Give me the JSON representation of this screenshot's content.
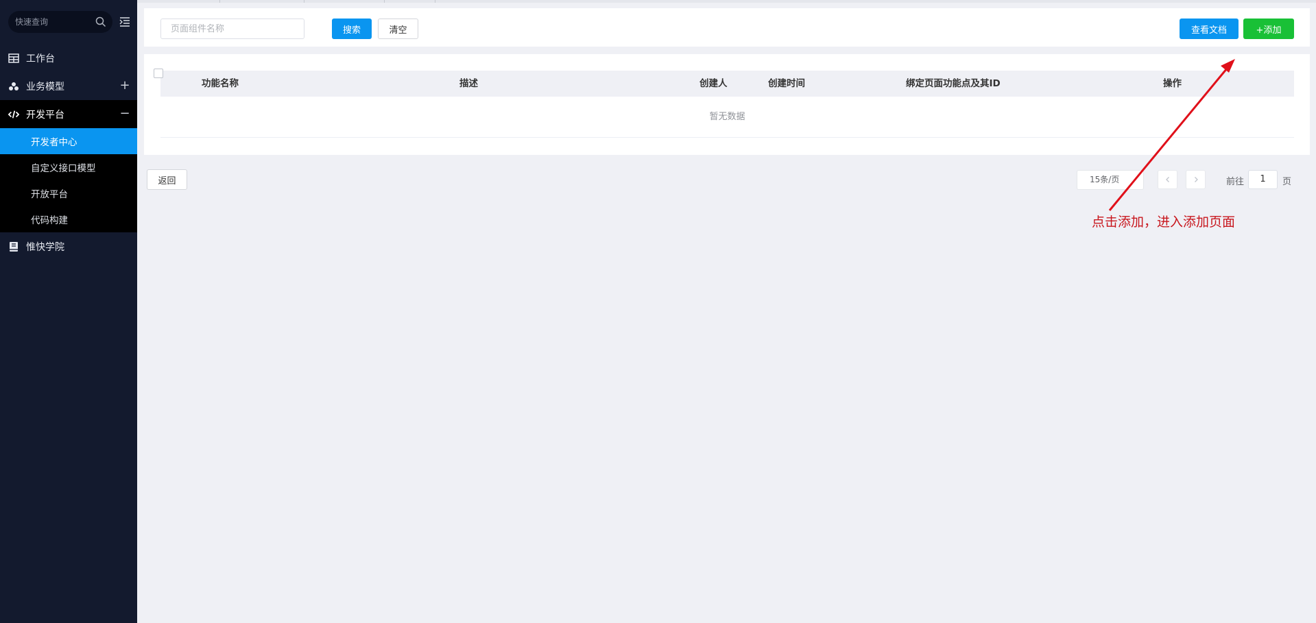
{
  "sidebar": {
    "search_placeholder": "快速查询",
    "items": [
      {
        "label": "工作台"
      },
      {
        "label": "业务模型",
        "toggle": "+"
      },
      {
        "label": "开发平台",
        "toggle": "−"
      },
      {
        "label": "惟快学院"
      }
    ],
    "subitems": [
      {
        "label": "开发者中心"
      },
      {
        "label": "自定义接口模型"
      },
      {
        "label": "开放平台"
      },
      {
        "label": "代码构建"
      }
    ]
  },
  "toolbar": {
    "search_placeholder": "页面组件名称",
    "search_label": "搜索",
    "clear_label": "清空",
    "docs_label": "查看文档",
    "add_label": "+添加"
  },
  "table": {
    "columns": [
      "功能名称",
      "描述",
      "创建人",
      "创建时间",
      "绑定页面功能点及其ID",
      "操作"
    ],
    "empty_text": "暂无数据"
  },
  "footer": {
    "back_label": "返回",
    "page_size": "15条/页",
    "goto_label": "前往",
    "page": "1",
    "page_suffix": "页"
  },
  "annotation": {
    "text": "点击添加，进入添加页面",
    "color": "#c8161d"
  },
  "colors": {
    "primary": "#0a95f0",
    "success": "#19c036",
    "sidebar_bg": "#131a2e"
  }
}
